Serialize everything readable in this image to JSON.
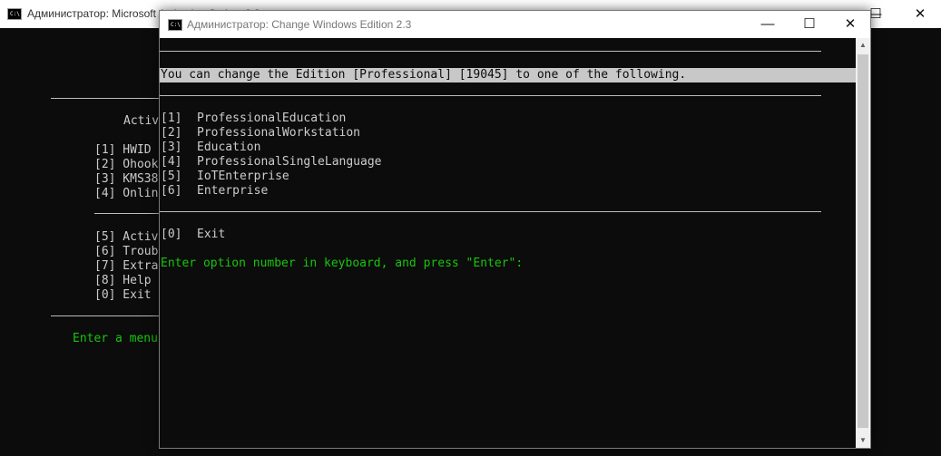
{
  "back_window": {
    "title": "Администратор:  Microsoft Activation Scripts 2.3",
    "heading": "Activ",
    "menu": [
      "[1] HWID",
      "[2] Ohook",
      "[3] KMS38",
      "[4] Onlin",
      "[5] Activ",
      "[6] Troub",
      "[7] Extra",
      "[8] Help",
      "[0] Exit"
    ],
    "prompt": "Enter a menu",
    "controls": {
      "minimize": "—",
      "maximize": "☐",
      "close": "✕"
    }
  },
  "front_window": {
    "title": "Администратор:  Change Windows Edition 2.3",
    "controls": {
      "minimize": "—",
      "maximize": "☐",
      "close": "✕"
    },
    "header_line": "You can change the Edition [Professional] [19045] to one of the following.",
    "options": [
      {
        "key": "[1]",
        "label": "ProfessionalEducation"
      },
      {
        "key": "[2]",
        "label": "ProfessionalWorkstation"
      },
      {
        "key": "[3]",
        "label": "Education"
      },
      {
        "key": "[4]",
        "label": "ProfessionalSingleLanguage"
      },
      {
        "key": "[5]",
        "label": "IoTEnterprise"
      },
      {
        "key": "[6]",
        "label": "Enterprise"
      }
    ],
    "exit_option": {
      "key": "[0]",
      "label": "Exit"
    },
    "prompt": "Enter option number in keyboard, and press \"Enter\":"
  },
  "icons": {
    "console": "cmd-icon"
  },
  "colors": {
    "console_bg": "#0c0c0c",
    "console_text": "#cccccc",
    "prompt_green": "#16c60c",
    "highlight": "#c8c8c8"
  }
}
